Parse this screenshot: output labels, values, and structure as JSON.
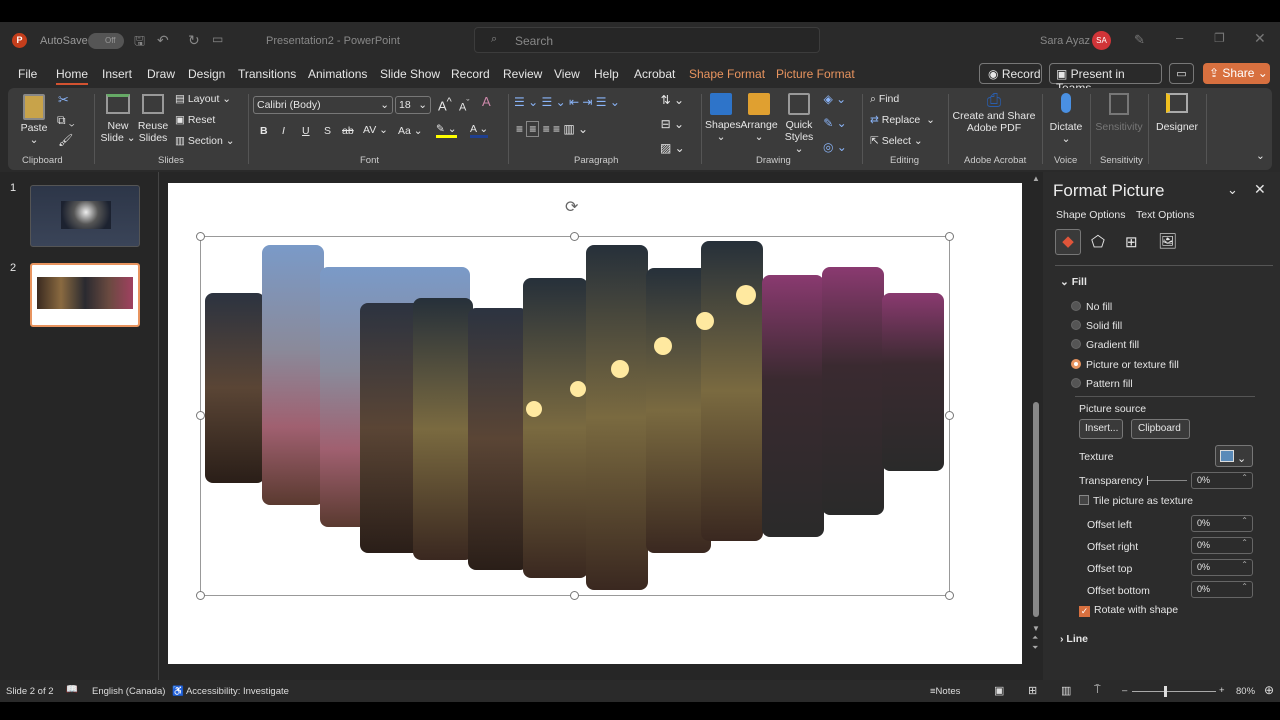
{
  "titlebar": {
    "autosave": "AutoSave",
    "autosave_state": "Off",
    "doc_title": "Presentation2 - PowerPoint",
    "search_placeholder": "Search",
    "user_name": "Sara Ayaz",
    "user_initials": "SA"
  },
  "tabs": [
    "File",
    "Home",
    "Insert",
    "Draw",
    "Design",
    "Transitions",
    "Animations",
    "Slide Show",
    "Record",
    "Review",
    "View",
    "Help",
    "Acrobat",
    "Shape Format",
    "Picture Format"
  ],
  "actions": {
    "record": "Record",
    "present_teams": "Present in Teams",
    "share": "Share"
  },
  "ribbon": {
    "clipboard": {
      "label": "Clipboard",
      "paste": "Paste"
    },
    "slides": {
      "label": "Slides",
      "new_slide": "New Slide",
      "reuse_slides": "Reuse Slides",
      "layout": "Layout",
      "reset": "Reset",
      "section": "Section"
    },
    "font": {
      "label": "Font",
      "font_name": "Calibri (Body)",
      "font_size": "18",
      "bold": "B",
      "italic": "I",
      "underline": "U",
      "shadow": "S",
      "spacing": "AV",
      "case": "Aa"
    },
    "paragraph": {
      "label": "Paragraph"
    },
    "drawing": {
      "label": "Drawing",
      "shapes": "Shapes",
      "arrange": "Arrange",
      "quick_styles": "Quick Styles"
    },
    "editing": {
      "label": "Editing",
      "find": "Find",
      "replace": "Replace",
      "select": "Select"
    },
    "acrobat": {
      "label": "Adobe Acrobat",
      "create": "Create and Share Adobe PDF"
    },
    "voice": {
      "label": "Voice",
      "dictate": "Dictate"
    },
    "sensitivity": {
      "label": "Sensitivity",
      "button": "Sensitivity"
    },
    "designer": {
      "button": "Designer"
    }
  },
  "thumbnails": [
    {
      "number": "1"
    },
    {
      "number": "2"
    }
  ],
  "panel": {
    "title": "Format Picture",
    "shape_options": "Shape Options",
    "text_options": "Text Options",
    "fill_header": "Fill",
    "fill_options": [
      {
        "label": "No fill",
        "selected": false
      },
      {
        "label": "Solid fill",
        "selected": false
      },
      {
        "label": "Gradient fill",
        "selected": false
      },
      {
        "label": "Picture or texture fill",
        "selected": true
      },
      {
        "label": "Pattern fill",
        "selected": false
      }
    ],
    "picture_source": "Picture source",
    "insert": "Insert...",
    "clipboard": "Clipboard",
    "texture": "Texture",
    "transparency": "Transparency",
    "transparency_value": "0%",
    "tile": "Tile picture as texture",
    "tile_checked": false,
    "offsets": [
      {
        "label": "Offset left",
        "value": "0%"
      },
      {
        "label": "Offset right",
        "value": "0%"
      },
      {
        "label": "Offset top",
        "value": "0%"
      },
      {
        "label": "Offset bottom",
        "value": "0%"
      }
    ],
    "rotate": "Rotate with shape",
    "rotate_checked": true,
    "line_header": "Line"
  },
  "status": {
    "slide": "Slide 2 of 2",
    "language": "English (Canada)",
    "accessibility": "Accessibility: Investigate",
    "notes": "Notes",
    "zoom": "80%"
  },
  "colors": {
    "accent": "#d35230",
    "share": "#d8703f",
    "context_tab": "#e8945f"
  }
}
